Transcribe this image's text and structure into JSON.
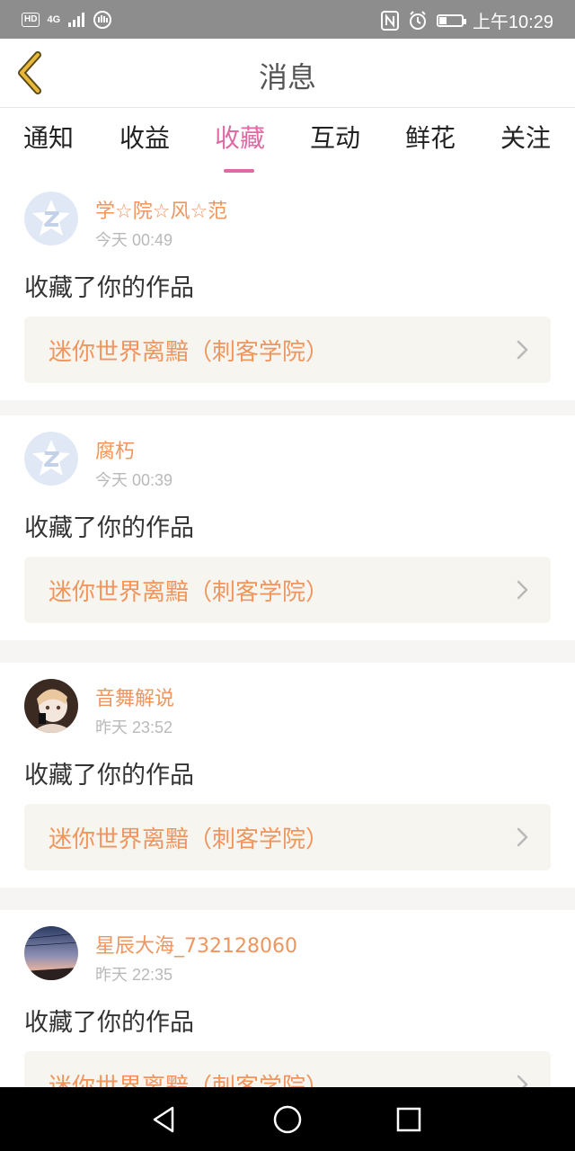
{
  "status_bar": {
    "hd": "HD",
    "network": "4G",
    "time": "上午10:29",
    "battery_level": 0.3
  },
  "header": {
    "title": "消息"
  },
  "tabs": [
    {
      "label": "通知",
      "active": false
    },
    {
      "label": "收益",
      "active": false
    },
    {
      "label": "收藏",
      "active": true
    },
    {
      "label": "互动",
      "active": false
    },
    {
      "label": "鲜花",
      "active": false
    },
    {
      "label": "关注",
      "active": false
    }
  ],
  "messages": [
    {
      "username": "学☆院☆风☆范",
      "time": "今天 00:49",
      "action": "收藏了你的作品",
      "work": "迷你世界离黯（刺客学院）",
      "avatar": "default-qq-avatar"
    },
    {
      "username": "腐朽",
      "time": "今天 00:39",
      "action": "收藏了你的作品",
      "work": "迷你世界离黯（刺客学院）",
      "avatar": "default-qq-avatar"
    },
    {
      "username": "音舞解说",
      "time": "昨天 23:52",
      "action": "收藏了你的作品",
      "work": "迷你世界离黯（刺客学院）",
      "avatar": "photo-avatar"
    },
    {
      "username": "星辰大海_732128060",
      "time": "昨天 22:35",
      "action": "收藏了你的作品",
      "work": "迷你世界离黯（刺客学院）",
      "avatar": "sky-photo-avatar"
    }
  ],
  "colors": {
    "accent": "#e06aa3",
    "username": "#f0955d",
    "link_bg": "#f6f5ef",
    "back_chevron": "#e8b83a"
  }
}
